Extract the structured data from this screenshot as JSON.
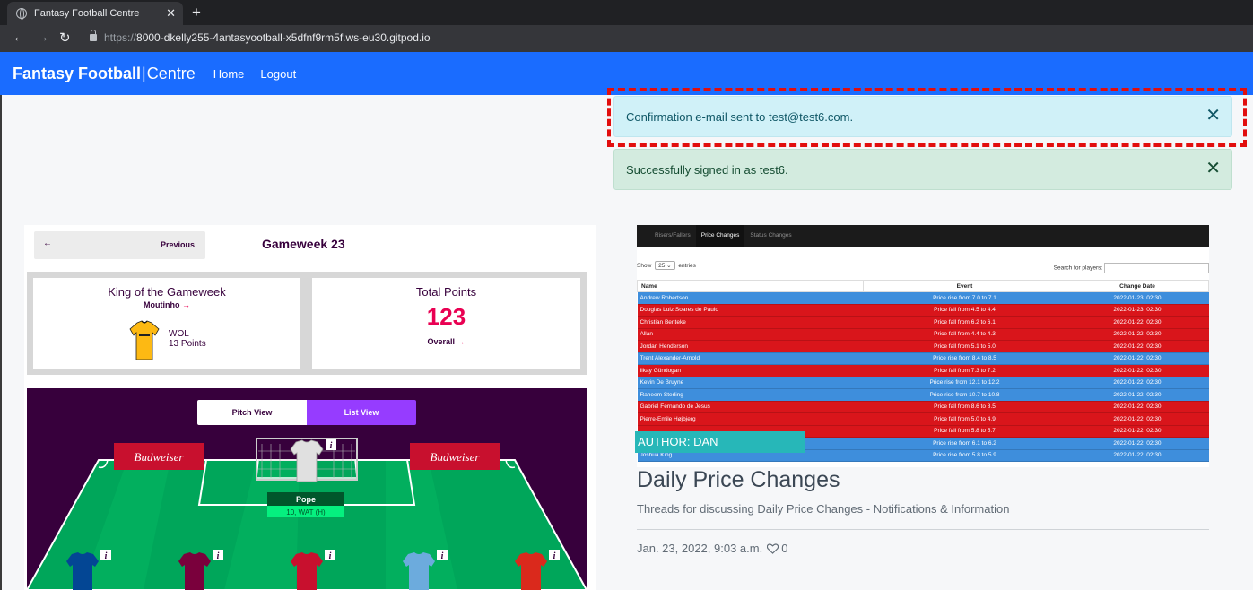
{
  "browser": {
    "tab_title": "Fantasy Football Centre",
    "tab_close": "✕",
    "new_tab": "+",
    "url_scheme": "https://",
    "url_host": "8000-dkelly255-4antasyootball-x5dfnf9rm5f.ws-eu30.gitpod.io"
  },
  "nav": {
    "brand_strong": "Fantasy Football",
    "brand_sep": "|",
    "brand_light": "Centre",
    "links": [
      "Home",
      "Logout"
    ]
  },
  "alerts": [
    {
      "text": "Confirmation e-mail sent to test@test6.com.",
      "close": "✕"
    },
    {
      "text": "Successfully signed in as test6.",
      "close": "✕"
    }
  ],
  "fpl": {
    "prev_arrow": "←",
    "prev_label": "Previous",
    "gameweek": "Gameweek 23",
    "king_title": "King of the Gameweek",
    "king_player": "Moutinho",
    "king_team": "WOL",
    "king_points": "13 Points",
    "total_title": "Total Points",
    "total_points": "123",
    "overall": "Overall",
    "link_arrow": "→",
    "view_pitch": "Pitch View",
    "view_list": "List View",
    "sponsor": "Budweiser",
    "gk_name": "Pope",
    "gk_fixture": "10, WAT (H)",
    "info": "i"
  },
  "price_table": {
    "tabs": [
      "Risers/Fallers",
      "Price Changes",
      "Status Changes"
    ],
    "active_tab": 1,
    "show_label": "Show",
    "show_value": "25",
    "entries_label": "entries",
    "search_label": "Search for players:",
    "headers": [
      "Name",
      "Event",
      "Change Date"
    ],
    "rows": [
      {
        "name": "Andrew Robertson",
        "event": "Price rise from 7.0 to 7.1",
        "date": "2022-01-23, 02:30",
        "kind": "rise"
      },
      {
        "name": "Douglas Luiz Soares de Paulo",
        "event": "Price fall from 4.5 to 4.4",
        "date": "2022-01-23, 02:30",
        "kind": "fall"
      },
      {
        "name": "Christian Benteke",
        "event": "Price fall from 6.2 to 6.1",
        "date": "2022-01-22, 02:30",
        "kind": "fall"
      },
      {
        "name": "Allan",
        "event": "Price fall from 4.4 to 4.3",
        "date": "2022-01-22, 02:30",
        "kind": "fall"
      },
      {
        "name": "Jordan Henderson",
        "event": "Price fall from 5.1 to 5.0",
        "date": "2022-01-22, 02:30",
        "kind": "fall"
      },
      {
        "name": "Trent Alexander-Arnold",
        "event": "Price rise from 8.4 to 8.5",
        "date": "2022-01-22, 02:30",
        "kind": "rise"
      },
      {
        "name": "Ilkay Gündogan",
        "event": "Price fall from 7.3 to 7.2",
        "date": "2022-01-22, 02:30",
        "kind": "fall"
      },
      {
        "name": "Kevin De Bruyne",
        "event": "Price rise from 12.1 to 12.2",
        "date": "2022-01-22, 02:30",
        "kind": "rise"
      },
      {
        "name": "Raheem Sterling",
        "event": "Price rise from 10.7 to 10.8",
        "date": "2022-01-22, 02:30",
        "kind": "rise"
      },
      {
        "name": "Gabriel Fernando de Jesus",
        "event": "Price fall from 8.6 to 8.5",
        "date": "2022-01-22, 02:30",
        "kind": "fall"
      },
      {
        "name": "Pierre-Emile Højbjerg",
        "event": "Price fall from 5.0 to 4.9",
        "date": "2022-01-22, 02:30",
        "kind": "fall"
      },
      {
        "name": "",
        "event": "Price fall from 5.8 to 5.7",
        "date": "2022-01-22, 02:30",
        "kind": "fall"
      },
      {
        "name": "",
        "event": "Price rise from 6.1 to 6.2",
        "date": "2022-01-22, 02:30",
        "kind": "rise"
      },
      {
        "name": "Joshua King",
        "event": "Price rise from 5.8 to 5.9",
        "date": "2022-01-22, 02:30",
        "kind": "rise"
      }
    ]
  },
  "post": {
    "author": "AUTHOR: DAN",
    "title": "Daily Price Changes",
    "subtitle": "Threads for discussing Daily Price Changes - Notifications & Information",
    "date": "Jan. 23, 2022, 9:03 a.m.",
    "likes": "0"
  },
  "colors": {
    "navbar": "#1a6cff",
    "rise_row": "#3e8edc",
    "fall_row": "#d9151b",
    "author_badge": "#27b7b8",
    "highlight_dash": "#e20e0e"
  }
}
